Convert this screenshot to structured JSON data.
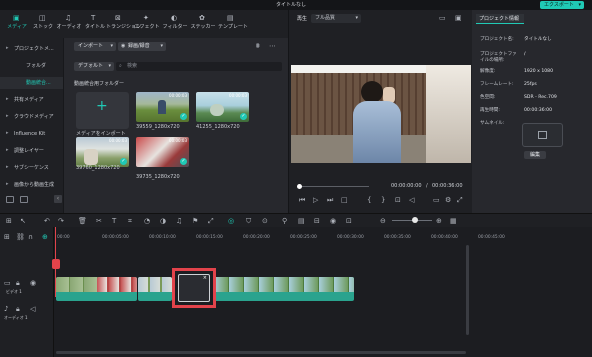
{
  "window": {
    "title": "タイトルなし",
    "export_label": "エクスポート"
  },
  "toolbar_tabs": [
    {
      "label": "メディア",
      "icon": "media-icon"
    },
    {
      "label": "ストック",
      "icon": "stock-icon"
    },
    {
      "label": "オーディオ",
      "icon": "audio-icon"
    },
    {
      "label": "タイトル",
      "icon": "title-icon"
    },
    {
      "label": "トランジション",
      "icon": "transition-icon"
    },
    {
      "label": "エフェクト",
      "icon": "effect-icon"
    },
    {
      "label": "フィルター",
      "icon": "filter-icon"
    },
    {
      "label": "ステッカー",
      "icon": "sticker-icon"
    },
    {
      "label": "テンプレート",
      "icon": "template-icon"
    }
  ],
  "sidebar": {
    "items": [
      "プロジェクトメ...",
      "フォルダ",
      "動画統合...",
      "共有メディア",
      "クラウドメディア",
      "Influence Kit",
      "調整レイヤー",
      "サブシーケンス",
      "画像から動画生成"
    ]
  },
  "media": {
    "import_label": "インポート",
    "record_label": "録画/録音",
    "default_label": "デフォルト",
    "search_placeholder": "検索",
    "folder_title": "動画統合用フォルダー",
    "import_tile_label": "メディアをインポート",
    "items": [
      {
        "name": "39559_1280x720",
        "duration": "00:00:03"
      },
      {
        "name": "41255_1280x720",
        "duration": "00:00:03"
      },
      {
        "name": "39760_1280x720",
        "duration": "00:00:03"
      },
      {
        "name": "39735_1280x720",
        "duration": "00:00:03"
      }
    ]
  },
  "player": {
    "tab_label": "再生",
    "quality": "フル品質",
    "current_time": "00:00:00:00",
    "separator": "/",
    "total_time": "00:00:36:00"
  },
  "project_info": {
    "tab": "プロジェクト情報",
    "rows": [
      {
        "k": "プロジェクト名:",
        "v": "タイトルなし"
      },
      {
        "k": "プロジェクトファイルの場所:",
        "v": "/"
      },
      {
        "k": "解像度:",
        "v": "1920 x 1080"
      },
      {
        "k": "フレームレート:",
        "v": "25fps"
      },
      {
        "k": "色空間:",
        "v": "SDR - Rec.709"
      },
      {
        "k": "再生時間:",
        "v": "00:00:36:00"
      },
      {
        "k": "サムネイル:",
        "v": ""
      }
    ],
    "edit_label": "編集"
  },
  "timeline": {
    "ruler": [
      "00:00",
      "00:00:05:00",
      "00:00:10:00",
      "00:00:15:00",
      "00:00:20:00",
      "00:00:25:00",
      "00:00:30:00",
      "00:00:35:00",
      "00:00:40:00",
      "00:00:45:00"
    ],
    "video_track": "ビデオ 1",
    "audio_track": "オーディオ 1"
  },
  "colors": {
    "accent": "#20c9b5",
    "highlight": "#e2434b"
  }
}
